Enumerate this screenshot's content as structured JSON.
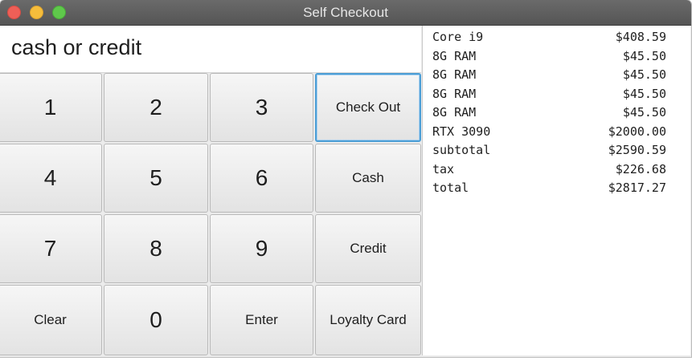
{
  "window": {
    "title": "Self Checkout"
  },
  "display": {
    "text": "cash or credit"
  },
  "keypad": {
    "k1": "1",
    "k2": "2",
    "k3": "3",
    "checkout": "Check Out",
    "k4": "4",
    "k5": "5",
    "k6": "6",
    "cash": "Cash",
    "k7": "7",
    "k8": "8",
    "k9": "9",
    "credit": "Credit",
    "clear": "Clear",
    "k0": "0",
    "enter": "Enter",
    "loyalty": "Loyalty Card"
  },
  "receipt": [
    {
      "name": "Core i9",
      "price": "$408.59"
    },
    {
      "name": "8G RAM",
      "price": "$45.50"
    },
    {
      "name": "8G RAM",
      "price": "$45.50"
    },
    {
      "name": "8G RAM",
      "price": "$45.50"
    },
    {
      "name": "8G RAM",
      "price": "$45.50"
    },
    {
      "name": "RTX 3090",
      "price": "$2000.00"
    },
    {
      "name": "subtotal",
      "price": "$2590.59"
    },
    {
      "name": "tax",
      "price": "$226.68"
    },
    {
      "name": "total",
      "price": "$2817.27"
    }
  ],
  "colors": {
    "accent": "#4b9ed6",
    "close": "#ee5f57",
    "minimize": "#f6bd3b",
    "zoom": "#5fc84b"
  }
}
